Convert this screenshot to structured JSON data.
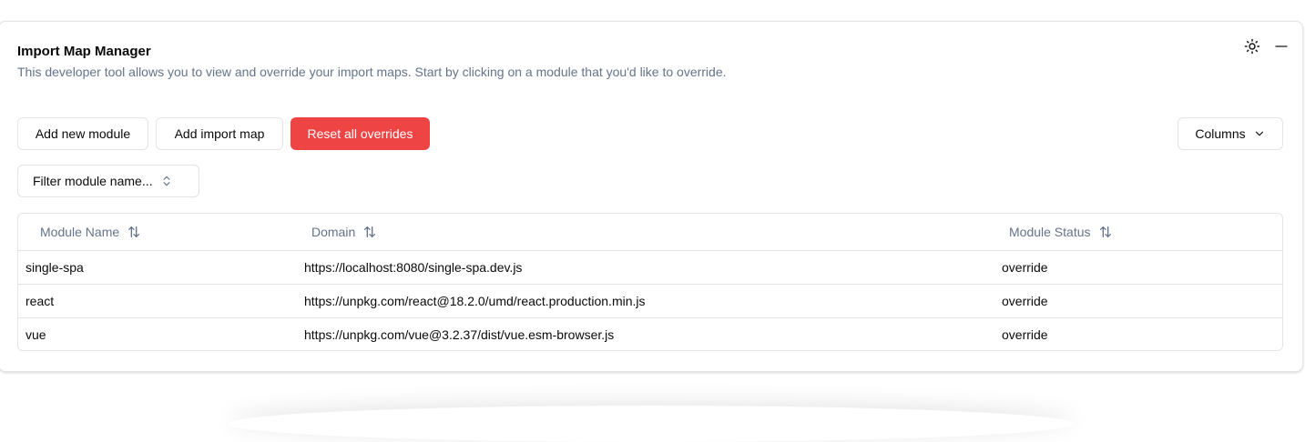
{
  "panel": {
    "title": "Import Map Manager",
    "description": "This developer tool allows you to view and override your import maps. Start by clicking on a module that you'd like to override.",
    "icons": {
      "theme": "sun-icon",
      "minimize": "minus-icon"
    }
  },
  "toolbar": {
    "add_module_label": "Add new module",
    "add_import_map_label": "Add import map",
    "reset_overrides_label": "Reset all overrides",
    "columns_label": "Columns",
    "filter_label": "Filter module name..."
  },
  "table": {
    "headers": [
      "Module Name",
      "Domain",
      "Module Status"
    ],
    "rows": [
      {
        "name": "single-spa",
        "domain": "https://localhost:8080/single-spa.dev.js",
        "status": "override"
      },
      {
        "name": "react",
        "domain": "https://unpkg.com/react@18.2.0/umd/react.production.min.js",
        "status": "override"
      },
      {
        "name": "vue",
        "domain": "https://unpkg.com/vue@3.2.37/dist/vue.esm-browser.js",
        "status": "override"
      }
    ]
  },
  "colors": {
    "danger": "#ef4444",
    "muted_text": "#64748b",
    "border": "#e4e4e7"
  }
}
